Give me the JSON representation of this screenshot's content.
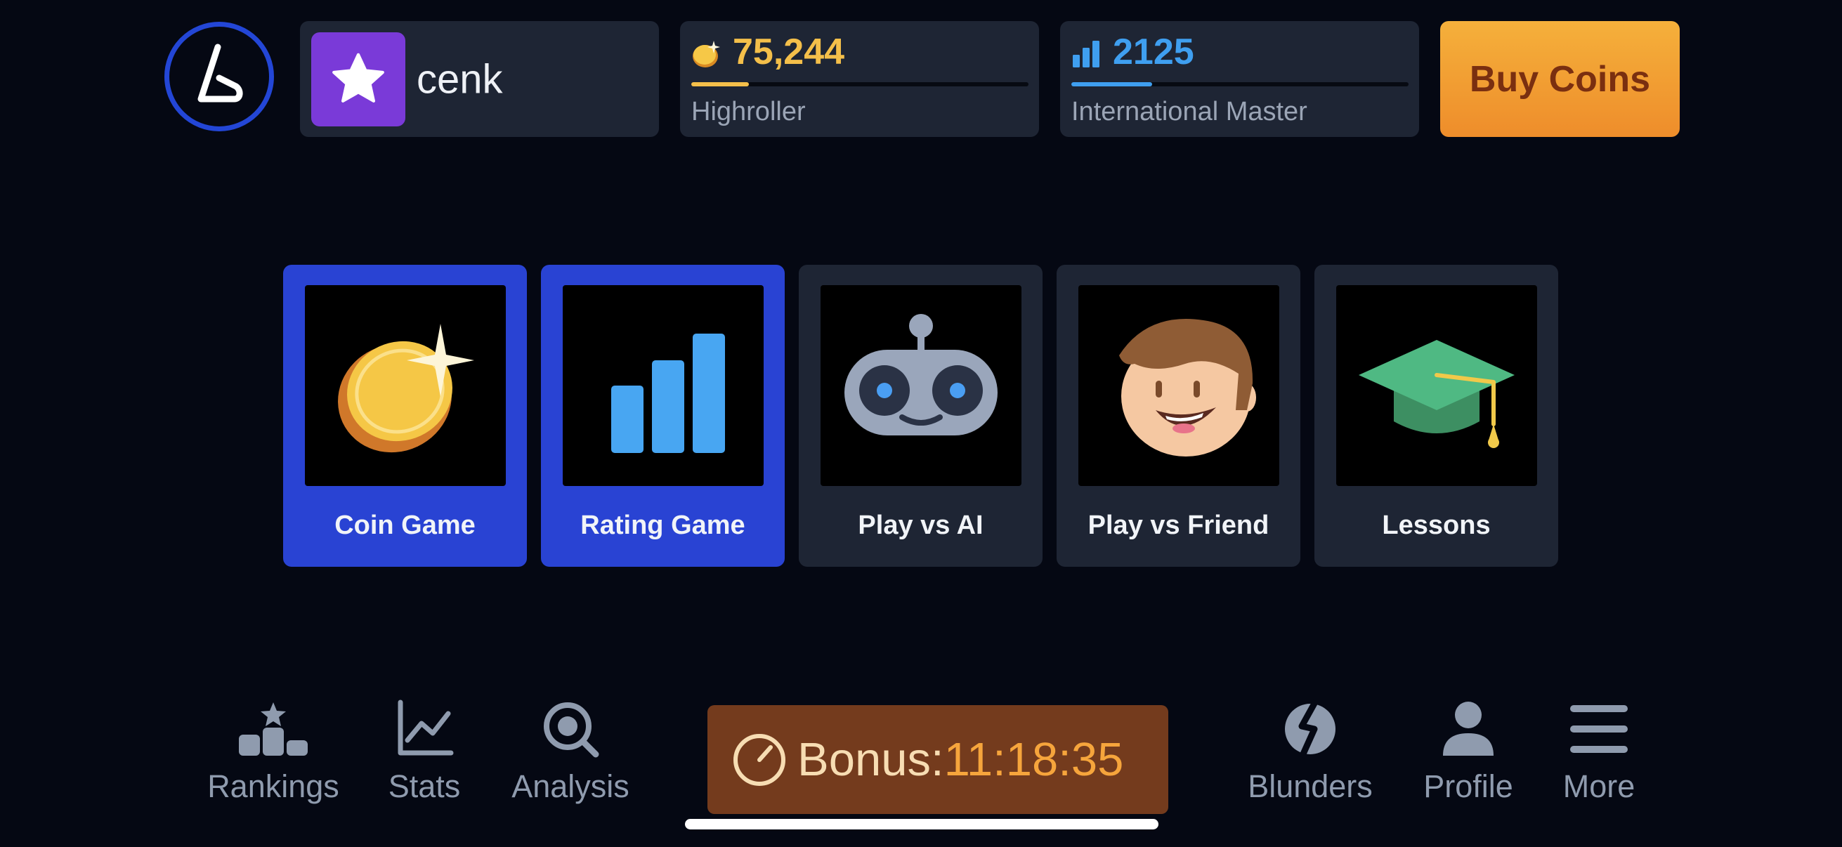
{
  "header": {
    "logo_icon": "app-logo-icon",
    "user": {
      "avatar_icon": "star-icon",
      "avatar_color": "#7a3ad8",
      "name": "cenk"
    },
    "coins": {
      "icon": "coin-icon",
      "value": "75,244",
      "value_color": "#f4bf4a",
      "progress": 0.17,
      "progress_color": "#f4bf4a",
      "label": "Highroller"
    },
    "rating": {
      "icon": "bar-chart-icon",
      "value": "2125",
      "value_color": "#3f9ff0",
      "progress": 0.24,
      "progress_color": "#3f9ff0",
      "label": "International Master"
    },
    "buy_button": "Buy Coins"
  },
  "modes": [
    {
      "label": "Coin Game",
      "icon": "coin-sparkle-icon",
      "active": true
    },
    {
      "label": "Rating Game",
      "icon": "bar-chart-icon",
      "active": true
    },
    {
      "label": "Play vs AI",
      "icon": "robot-icon",
      "active": false
    },
    {
      "label": "Play vs Friend",
      "icon": "friend-face-icon",
      "active": false
    },
    {
      "label": "Lessons",
      "icon": "graduation-cap-icon",
      "active": false
    }
  ],
  "nav": {
    "rankings": "Rankings",
    "stats": "Stats",
    "analysis": "Analysis",
    "blunders": "Blunders",
    "profile": "Profile",
    "more": "More"
  },
  "bonus": {
    "label": "Bonus:",
    "time": "11:18:35",
    "icon": "timer-icon"
  },
  "colors": {
    "background": "#050813",
    "panel": "#1e2534",
    "accent_blue": "#2943d3",
    "accent_orange": "#f5a33a",
    "bonus_bg": "#743b1d"
  }
}
